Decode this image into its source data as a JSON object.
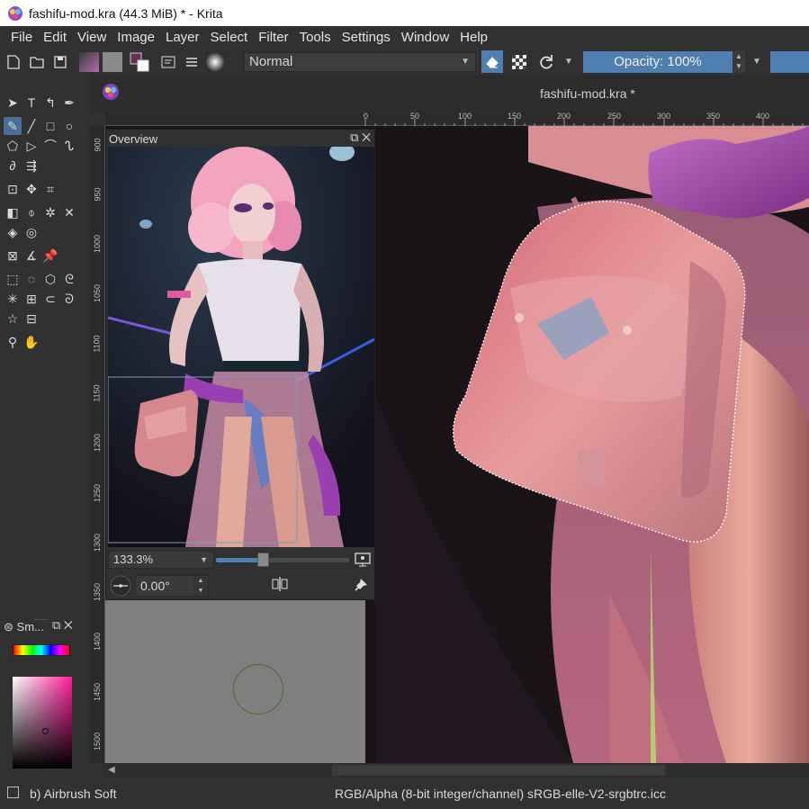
{
  "window": {
    "title": "fashifu-mod.kra (44.3 MiB)  * - Krita"
  },
  "menu": {
    "items": [
      "File",
      "Edit",
      "View",
      "Image",
      "Layer",
      "Select",
      "Filter",
      "Tools",
      "Settings",
      "Window",
      "Help"
    ]
  },
  "tool_options": {
    "blend_mode": "Normal",
    "opacity_label": "Opacity: 100%"
  },
  "document": {
    "tab_title": "fashifu-mod.kra *"
  },
  "rulers": {
    "horizontal": [
      "0",
      "50",
      "100",
      "150",
      "200",
      "250",
      "300",
      "350",
      "400"
    ],
    "vertical": [
      "900",
      "950",
      "1000",
      "1050",
      "1100",
      "1150",
      "1200",
      "1250",
      "1300",
      "1350",
      "1400",
      "1450",
      "1500"
    ]
  },
  "overview": {
    "title": "Overview",
    "zoom": "133.3%",
    "zoom_fraction": 0.35,
    "rotation": "0.00°"
  },
  "small_color_selector": {
    "title": "Sm..."
  },
  "status": {
    "brush": "b) Airbrush Soft",
    "color_info": "RGB/Alpha (8-bit integer/channel)  sRGB-elle-V2-srgbtrc.icc"
  },
  "colors": {
    "accent": "#4f7fb0",
    "background": "#313131"
  }
}
